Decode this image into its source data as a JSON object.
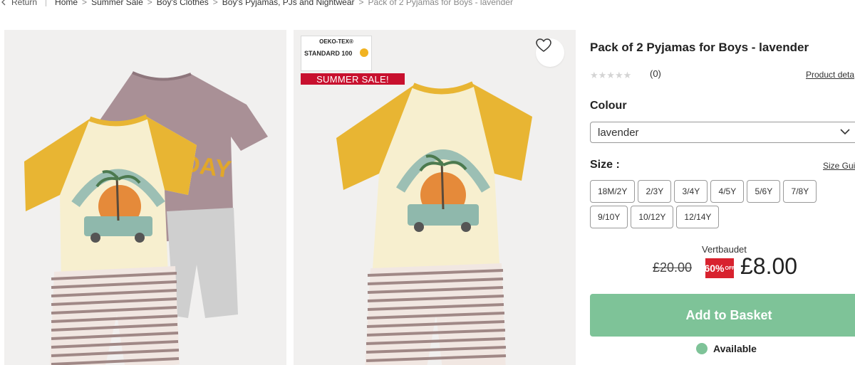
{
  "breadcrumb": {
    "return_label": "Return",
    "items": [
      "Home",
      "Summer Sale",
      "Boy's Clothes",
      "Boy's Pyjamas, PJs and Nightwear",
      "Pack of 2 Pyjamas for Boys - lavender"
    ]
  },
  "gallery": {
    "badge": {
      "oeko_title": "OEKO-TEX®",
      "standard": "STANDARD 100",
      "sale_label": "SUMMER SALE!"
    }
  },
  "product": {
    "title": "Pack of 2 Pyjamas for Boys - lavender",
    "stars": "★★★★★",
    "review_count": "(0)",
    "details_link": "Product deta",
    "colour_label": "Colour",
    "colour_value": "lavender",
    "size_label": "Size :",
    "size_guide": "Size Gui",
    "sizes": [
      "18M/2Y",
      "2/3Y",
      "3/4Y",
      "4/5Y",
      "5/6Y",
      "7/8Y",
      "9/10Y",
      "10/12Y",
      "12/14Y"
    ],
    "brand": "Vertbaudet",
    "old_price": "£20.00",
    "discount": "60%",
    "discount_suffix": "OFF",
    "price": "£8.00",
    "basket_label": "Add to Basket",
    "availability": "Available"
  },
  "colors": {
    "accent_green": "#7ec398",
    "sale_red": "#c8102e",
    "discount_red": "#d8222e",
    "tshirt_body": "#f7efcf",
    "tshirt_sleeve": "#e8b533",
    "tshirt_lavender": "#a99096"
  }
}
